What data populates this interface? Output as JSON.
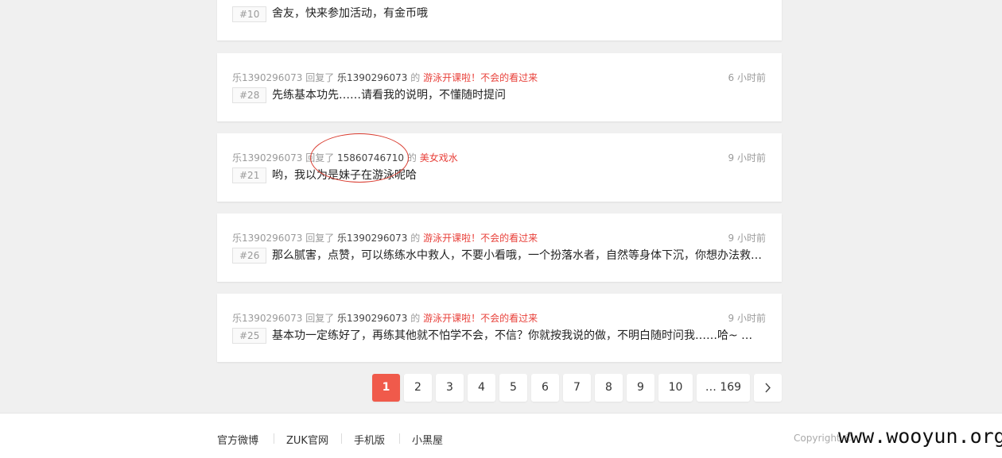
{
  "posts": [
    {
      "floor": "#10",
      "text": "舍友，快来参加活动，有金币哦"
    },
    {
      "user": "乐1390296073",
      "verb": "回复了",
      "target": "乐1390296073",
      "of": "的",
      "topic": "游泳开课啦！不会的看过来",
      "time": "6 小时前",
      "floor": "#28",
      "text": "先练基本功先……请看我的说明，不懂随时提问"
    },
    {
      "user": "乐1390296073",
      "verb": "回复了",
      "target": "15860746710",
      "of": "的",
      "topic": "美女戏水",
      "time": "9 小时前",
      "floor": "#21",
      "text": "哟，我以为是妹子在游泳呢哈"
    },
    {
      "user": "乐1390296073",
      "verb": "回复了",
      "target": "乐1390296073",
      "of": "的",
      "topic": "游泳开课啦！不会的看过来",
      "time": "9 小时前",
      "floor": "#26",
      "text": "那么腻害，点赞，可以练练水中救人，不要小看哦，一个扮落水者，自然等身体下沉，你想办法救…"
    },
    {
      "user": "乐1390296073",
      "verb": "回复了",
      "target": "乐1390296073",
      "of": "的",
      "topic": "游泳开课啦！不会的看过来",
      "time": "9 小时前",
      "floor": "#25",
      "text": "基本功一定练好了，再练其他就不怕学不会，不信？你就按我说的做，不明白随时问我……哈~ …"
    }
  ],
  "pagination": {
    "pages": [
      "1",
      "2",
      "3",
      "4",
      "5",
      "6",
      "7",
      "8",
      "9",
      "10",
      "… 169"
    ],
    "current": "1",
    "next_icon": "chevron-right-icon"
  },
  "footer": {
    "links": [
      "官方微博",
      "ZUK官网",
      "手机版",
      "小黑屋"
    ],
    "copyright": "Copyright ©",
    "watermark": "www.wooyun.org"
  },
  "colors": {
    "accent": "#f05a4b",
    "topic_link": "#e8403a",
    "background": "#f0f0f0"
  }
}
